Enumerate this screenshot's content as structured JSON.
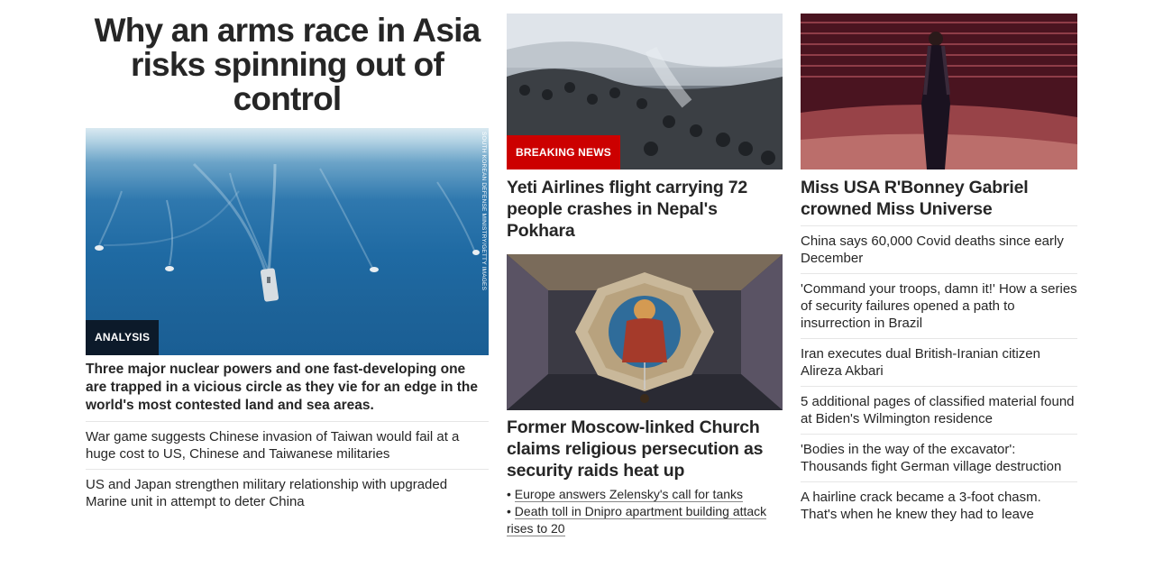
{
  "left": {
    "headline": "Why an arms race in Asia risks spinning out of control",
    "image_credit": "SOUTH KOREAN DEFENSE MINISTRY/GETTY IMAGES",
    "badge": "ANALYSIS",
    "description": "Three major nuclear powers and one fast-developing one are trapped in a vicious circle as they vie for an edge in the world's most contested land and sea areas.",
    "links": [
      "War game suggests Chinese invasion of Taiwan would fail at a huge cost to US, Chinese and Taiwanese militaries",
      "US and Japan strengthen military relationship with upgraded Marine unit in attempt to deter China"
    ]
  },
  "middle": {
    "story1": {
      "badge": "BREAKING NEWS",
      "headline": "Yeti Airlines flight carrying 72 people crashes in Nepal's Pokhara"
    },
    "story2": {
      "headline": "Former Moscow-linked Church claims religious persecution as security raids heat up",
      "bullets": [
        "Europe answers Zelensky's call for tanks",
        "Death toll in Dnipro apartment building attack rises to 20"
      ]
    }
  },
  "right": {
    "headline": "Miss USA R'Bonney Gabriel crowned Miss Universe",
    "links": [
      "China says 60,000 Covid deaths since early December",
      "'Command your troops, damn it!' How a series of security failures opened a path to insurrection in Brazil",
      "Iran executes dual British-Iranian citizen Alireza Akbari",
      "5 additional pages of classified material found at Biden's Wilmington residence",
      "'Bodies in the way of the excavator': Thousands fight German village destruction",
      "A hairline crack became a 3-foot chasm. That's when he knew they had to leave"
    ]
  }
}
